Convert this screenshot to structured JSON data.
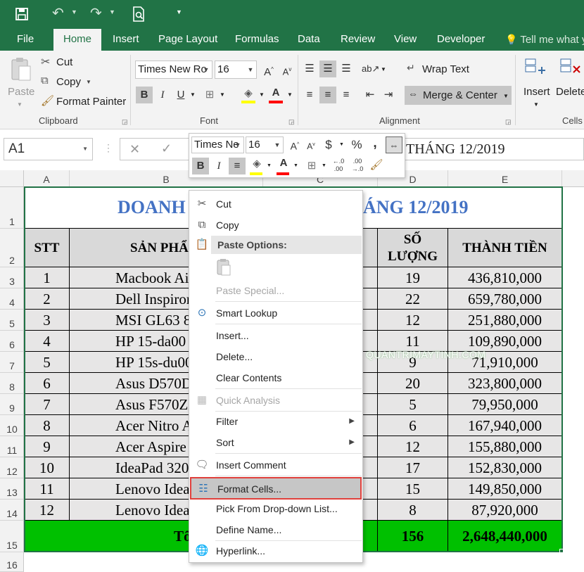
{
  "qat": {
    "save_icon": "save-icon",
    "undo_icon": "undo-icon",
    "redo_icon": "redo-icon",
    "preview_icon": "print-preview-icon",
    "customize_icon": "customize-qat-icon"
  },
  "tabs": [
    {
      "label": "File"
    },
    {
      "label": "Home"
    },
    {
      "label": "Insert"
    },
    {
      "label": "Page Layout"
    },
    {
      "label": "Formulas"
    },
    {
      "label": "Data"
    },
    {
      "label": "Review"
    },
    {
      "label": "View"
    },
    {
      "label": "Developer"
    }
  ],
  "tell_me": "Tell me what y",
  "clipboard": {
    "paste": "Paste",
    "cut": "Cut",
    "copy": "Copy",
    "format_painter": "Format Painter",
    "label": "Clipboard"
  },
  "font": {
    "name": "Times New Ro",
    "size": "16",
    "bold": "B",
    "italic": "I",
    "underline": "U",
    "grow": "A",
    "shrink": "A",
    "font_color": "A",
    "label": "Font"
  },
  "alignment": {
    "wrap_text": "Wrap Text",
    "merge_center": "Merge & Center",
    "label": "Alignment"
  },
  "cells": {
    "insert": "Insert",
    "delete": "Delete",
    "label": "Cells"
  },
  "formula_bar": {
    "name_box": "A1",
    "formula": "THÁNG 12/2019",
    "cancel": "✕",
    "enter": "✓"
  },
  "columns": [
    "A",
    "B",
    "C",
    "D",
    "E"
  ],
  "rows": [
    "1",
    "2",
    "3",
    "4",
    "5",
    "6",
    "7",
    "8",
    "9",
    "10",
    "11",
    "12",
    "13",
    "14",
    "15",
    "16"
  ],
  "sheet": {
    "title_left": "DOANH",
    "title_right": "ÁNG 12/2019",
    "headers": {
      "stt": "STT",
      "product": "SẢN PHẨ",
      "qty_line1": "SỐ",
      "qty_line2": "LƯỢNG",
      "amount": "THÀNH TIỀN"
    },
    "data": [
      {
        "stt": "1",
        "product": "Macbook Air 1",
        "qty": "19",
        "amount": "436,810,000"
      },
      {
        "stt": "2",
        "product": "Dell Inspiron G",
        "qty": "22",
        "amount": "659,780,000"
      },
      {
        "stt": "3",
        "product": "MSI GL63 8RC",
        "qty": "12",
        "amount": "251,880,000"
      },
      {
        "stt": "4",
        "product": "HP 15-da00",
        "qty": "11",
        "amount": "109,890,000"
      },
      {
        "stt": "5",
        "product": "HP 15s-du00",
        "qty": "9",
        "amount": "71,910,000"
      },
      {
        "stt": "6",
        "product": "Asus D570DD-E",
        "qty": "20",
        "amount": "323,800,000"
      },
      {
        "stt": "7",
        "product": "Asus F570ZD-",
        "qty": "5",
        "amount": "79,950,000"
      },
      {
        "stt": "8",
        "product": "Acer Nitro AN51",
        "qty": "6",
        "amount": "167,940,000"
      },
      {
        "stt": "9",
        "product": "Acer Aspire A31",
        "qty": "12",
        "amount": "155,880,000"
      },
      {
        "stt": "10",
        "product": "IdeaPad 320-",
        "qty": "17",
        "amount": "152,830,000"
      },
      {
        "stt": "11",
        "product": "Lenovo Ideapad",
        "qty": "15",
        "amount": "149,850,000"
      },
      {
        "stt": "12",
        "product": "Lenovo Ideapa",
        "qty": "8",
        "amount": "87,920,000"
      }
    ],
    "total_label": "Tổ",
    "total_qty": "156",
    "total_amount": "2,648,440,000",
    "watermark": "QUANTRIMAYTINH.COM"
  },
  "mini_toolbar": {
    "font": "Times Ne",
    "size": "16",
    "currency": "$",
    "percent": "%",
    "comma": ",",
    "bold": "B",
    "italic": "I",
    "font_color": "A"
  },
  "context_menu": {
    "cut": "Cut",
    "copy": "Copy",
    "paste_options": "Paste Options:",
    "paste_special": "Paste Special...",
    "smart_lookup": "Smart Lookup",
    "insert": "Insert...",
    "delete": "Delete...",
    "clear_contents": "Clear Contents",
    "quick_analysis": "Quick Analysis",
    "filter": "Filter",
    "sort": "Sort",
    "insert_comment": "Insert Comment",
    "format_cells": "Format Cells...",
    "pick_list": "Pick From Drop-down List...",
    "define_name": "Define Name...",
    "hyperlink": "Hyperlink..."
  },
  "colors": {
    "excel_green": "#217346",
    "highlight_red": "#e0403c",
    "title_blue": "#4472c4",
    "total_green": "#00c000"
  }
}
